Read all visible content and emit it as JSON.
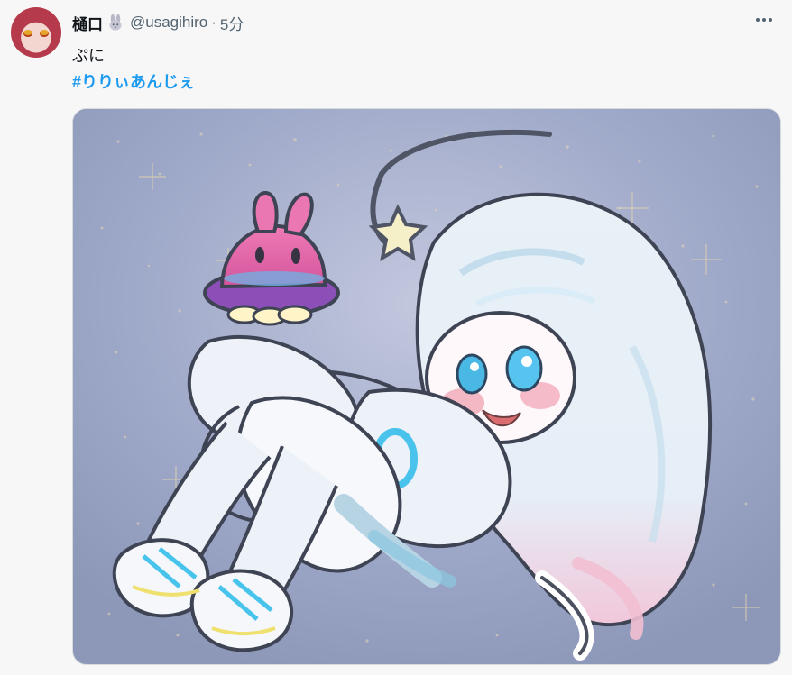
{
  "tweet": {
    "author": {
      "display_name": "樋口",
      "handle": "@usagihiro",
      "badge_icon": "bunny-icon",
      "avatar_icon": "avatar-image"
    },
    "separator": "·",
    "time": "5分",
    "text": "ぷに",
    "hashtag": "#りりぃあんじぇ",
    "more_icon": "more-options-icon",
    "colors": {
      "name": "#0f1419",
      "meta": "#536471",
      "hashtag": "#1d9bf0",
      "media_bg": "#a8b1cc"
    }
  }
}
